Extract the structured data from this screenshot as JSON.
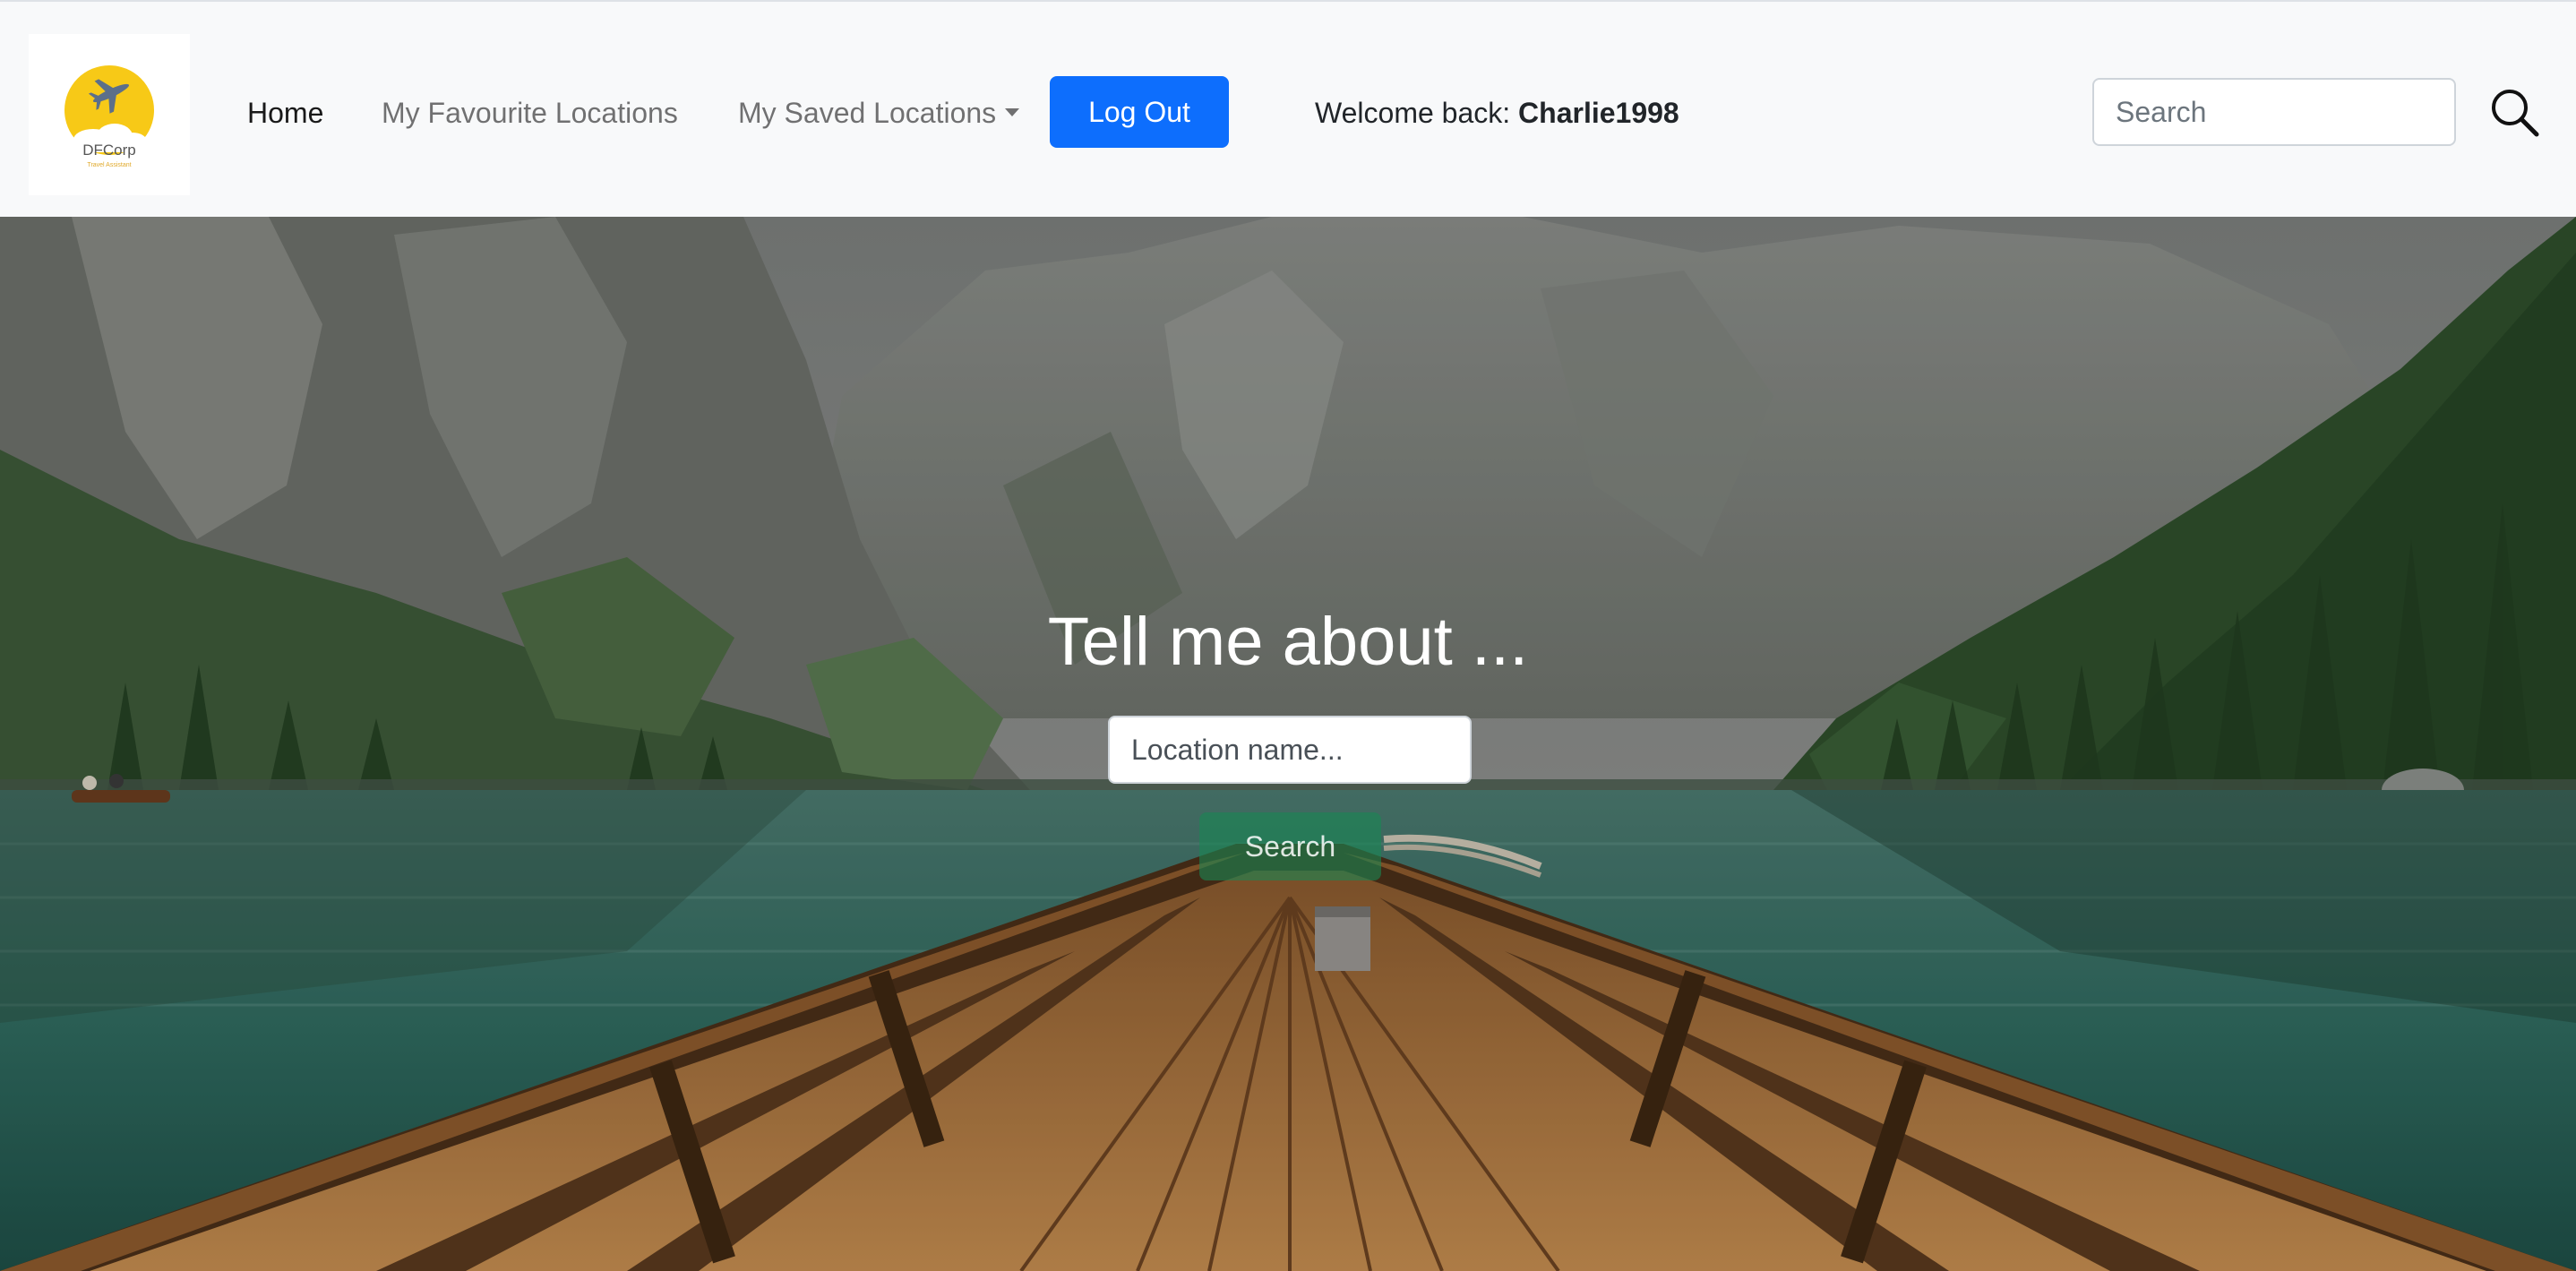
{
  "brand": {
    "name": "DFCorp",
    "tagline": "Travel Assistant",
    "logo_color": "#f7c917",
    "plane_color": "#5c6f8a"
  },
  "nav": {
    "home_label": "Home",
    "favourites_label": "My Favourite Locations",
    "saved_label": "My Saved Locations",
    "logout_label": "Log Out",
    "welcome_prefix": "Welcome back: ",
    "username": "Charlie1998",
    "search_placeholder": "Search",
    "accent_color": "#0d6efd"
  },
  "hero": {
    "title": "Tell me about ...",
    "location_placeholder": "Location name...",
    "search_button_label": "Search",
    "search_button_color": "#198754"
  }
}
